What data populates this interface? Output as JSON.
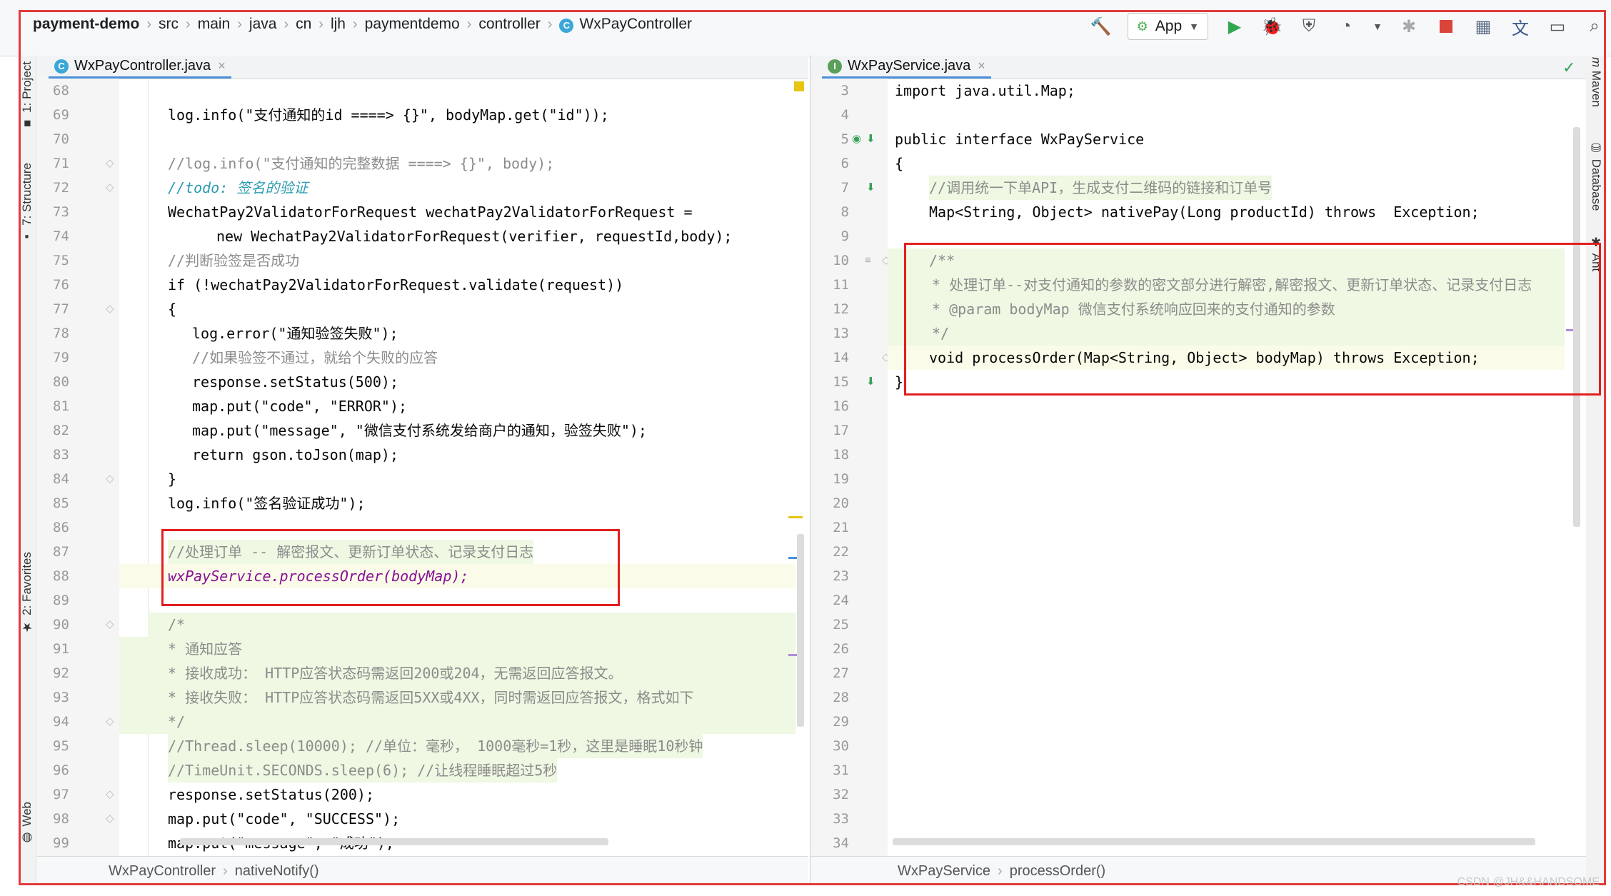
{
  "navbar": {
    "breadcrumbs": [
      "payment-demo",
      "src",
      "main",
      "java",
      "cn",
      "ljh",
      "paymentdemo",
      "controller",
      "WxPayController"
    ],
    "run_config": "App"
  },
  "tool_windows": {
    "left": [
      "1: Project",
      "7: Structure",
      "2: Favorites",
      "Web"
    ],
    "right": [
      "Maven",
      "Database",
      "Ant"
    ]
  },
  "left_editor": {
    "tab": "WxPayController.java",
    "lines": [
      {
        "n": "68",
        "text": ""
      },
      {
        "n": "69",
        "text": "log.info(\"支付通知的id ====> {}\", bodyMap.get(\"id\"));"
      },
      {
        "n": "70",
        "text": ""
      },
      {
        "n": "71",
        "text": "//log.info(\"支付通知的完整数据 ====> {}\", body);"
      },
      {
        "n": "72",
        "text": "//todo: 签名的验证"
      },
      {
        "n": "73",
        "text": "WechatPay2ValidatorForRequest wechatPay2ValidatorForRequest ="
      },
      {
        "n": "74",
        "text": "new WechatPay2ValidatorForRequest(verifier, requestId,body);"
      },
      {
        "n": "75",
        "text": "//判断验签是否成功"
      },
      {
        "n": "76",
        "text": "if (!wechatPay2ValidatorForRequest.validate(request))"
      },
      {
        "n": "77",
        "text": "{"
      },
      {
        "n": "78",
        "text": "log.error(\"通知验签失败\");"
      },
      {
        "n": "79",
        "text": "//如果验签不通过，就给个失败的应答"
      },
      {
        "n": "80",
        "text": "response.setStatus(500);"
      },
      {
        "n": "81",
        "text": "map.put(\"code\", \"ERROR\");"
      },
      {
        "n": "82",
        "text": "map.put(\"message\", \"微信支付系统发给商户的通知，验签失败\");"
      },
      {
        "n": "83",
        "text": "return gson.toJson(map);"
      },
      {
        "n": "84",
        "text": "}"
      },
      {
        "n": "85",
        "text": "log.info(\"签名验证成功\");"
      },
      {
        "n": "86",
        "text": ""
      },
      {
        "n": "87",
        "text": "//处理订单 -- 解密报文、更新订单状态、记录支付日志"
      },
      {
        "n": "88",
        "text": "wxPayService.processOrder(bodyMap);"
      },
      {
        "n": "89",
        "text": ""
      },
      {
        "n": "90",
        "text": "/*"
      },
      {
        "n": "91",
        "text": "* 通知应答"
      },
      {
        "n": "92",
        "text": "* 接收成功： HTTP应答状态码需返回200或204，无需返回应答报文。"
      },
      {
        "n": "93",
        "text": "* 接收失败： HTTP应答状态码需返回5XX或4XX，同时需返回应答报文，格式如下"
      },
      {
        "n": "94",
        "text": "*/"
      },
      {
        "n": "95",
        "text": "//Thread.sleep(10000); //单位：毫秒， 1000毫秒=1秒，这里是睡眠10秒钟"
      },
      {
        "n": "96",
        "text": "//TimeUnit.SECONDS.sleep(6); //让线程睡眠超过5秒"
      },
      {
        "n": "97",
        "text": "response.setStatus(200);"
      },
      {
        "n": "98",
        "text": "map.put(\"code\", \"SUCCESS\");"
      },
      {
        "n": "99",
        "text": "map.put(\"message\", \"成功\");"
      }
    ],
    "footer": [
      "WxPayController",
      "nativeNotify()"
    ]
  },
  "right_editor": {
    "tab": "WxPayService.java",
    "lines": [
      {
        "n": "3",
        "text": "import java.util.Map;"
      },
      {
        "n": "4",
        "text": ""
      },
      {
        "n": "5",
        "text": "public interface WxPayService"
      },
      {
        "n": "6",
        "text": "{"
      },
      {
        "n": "7",
        "text": "//调用统一下单API，生成支付二维码的链接和订单号"
      },
      {
        "n": "8",
        "text": "Map<String, Object> nativePay(Long productId) throws  Exception;"
      },
      {
        "n": "9",
        "text": ""
      },
      {
        "n": "10",
        "text": "/**"
      },
      {
        "n": "11",
        "text": "* 处理订单--对支付通知的参数的密文部分进行解密,解密报文、更新订单状态、记录支付日志"
      },
      {
        "n": "12",
        "text": "* @param bodyMap 微信支付系统响应回来的支付通知的参数"
      },
      {
        "n": "13",
        "text": "*/"
      },
      {
        "n": "14",
        "text": "void processOrder(Map<String, Object> bodyMap) throws Exception;"
      },
      {
        "n": "15",
        "text": "}"
      },
      {
        "n": "16",
        "text": ""
      },
      {
        "n": "17",
        "text": ""
      },
      {
        "n": "18",
        "text": ""
      },
      {
        "n": "19",
        "text": ""
      },
      {
        "n": "20",
        "text": ""
      },
      {
        "n": "21",
        "text": ""
      },
      {
        "n": "22",
        "text": ""
      },
      {
        "n": "23",
        "text": ""
      },
      {
        "n": "24",
        "text": ""
      },
      {
        "n": "25",
        "text": ""
      },
      {
        "n": "26",
        "text": ""
      },
      {
        "n": "27",
        "text": ""
      },
      {
        "n": "28",
        "text": ""
      },
      {
        "n": "29",
        "text": ""
      },
      {
        "n": "30",
        "text": ""
      },
      {
        "n": "31",
        "text": ""
      },
      {
        "n": "32",
        "text": ""
      },
      {
        "n": "33",
        "text": ""
      },
      {
        "n": "34",
        "text": ""
      }
    ],
    "footer": [
      "WxPayService",
      "processOrder()"
    ]
  },
  "watermark": "CSDN @JH&&HANDSOME",
  "colors": {
    "highlight_box": "#e21f1f",
    "keyword": "#0033b3",
    "string": "#067d17",
    "comment": "#8c8c8c"
  }
}
